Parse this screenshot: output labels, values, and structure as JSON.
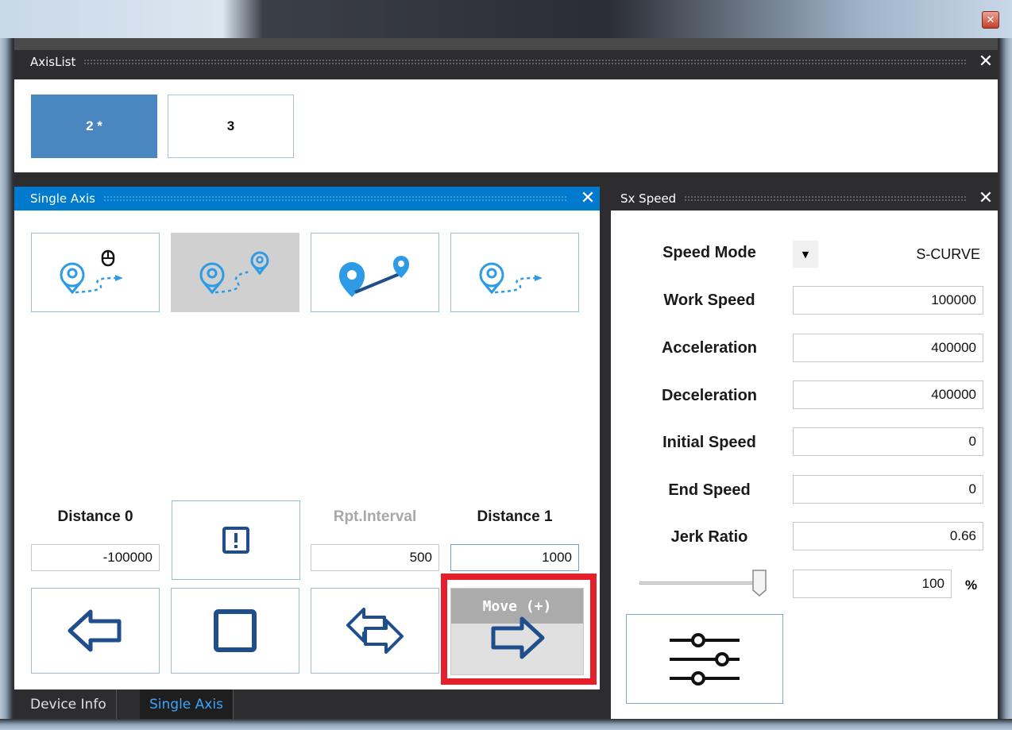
{
  "window": {
    "close_glyph": "✕"
  },
  "axis_list": {
    "title": "AxisList",
    "close_glyph": "✕",
    "buttons": [
      {
        "label": "2 *",
        "selected": true
      },
      {
        "label": "3",
        "selected": false
      }
    ]
  },
  "single_axis": {
    "title": "Single Axis",
    "close_glyph": "✕",
    "mode_icons": [
      "location-mouse-path-icon",
      "location-to-location-icon",
      "point-to-point-icon",
      "location-path-icon"
    ],
    "selected_mode_index": 1,
    "distance0": {
      "label": "Distance 0",
      "value": "-100000"
    },
    "rpt_interval": {
      "label": "Rpt.Interval",
      "value": "500"
    },
    "distance1": {
      "label": "Distance 1",
      "value": "1000"
    },
    "move_plus_label": "Move (+)"
  },
  "tabs": [
    {
      "label": "Device Info",
      "active": false
    },
    {
      "label": "Single Axis",
      "active": true
    }
  ],
  "sx_speed": {
    "title": "Sx Speed",
    "close_glyph": "✕",
    "speed_mode": {
      "label": "Speed Mode",
      "value": "S-CURVE"
    },
    "fields": [
      {
        "label": "Work Speed",
        "value": "100000"
      },
      {
        "label": "Acceleration",
        "value": "400000"
      },
      {
        "label": "Deceleration",
        "value": "400000"
      },
      {
        "label": "Initial Speed",
        "value": "0"
      },
      {
        "label": "End Speed",
        "value": "0"
      },
      {
        "label": "Jerk Ratio",
        "value": "0.66"
      }
    ],
    "override_slider_fraction": 0.95,
    "override_value": "100",
    "override_unit": "%"
  },
  "colors": {
    "accent": "#007acc",
    "selected_axis": "#4a86c0",
    "icon_blue": "#2e9be6",
    "icon_navy": "#1f4e8c",
    "highlight": "#e4202a"
  }
}
